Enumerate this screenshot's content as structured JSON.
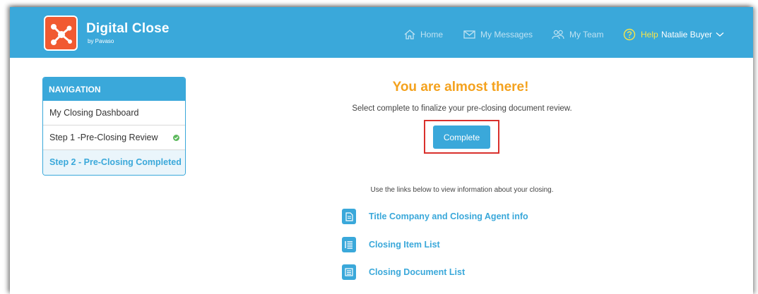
{
  "header": {
    "brand_title": "Digital Close",
    "brand_sub": "by Pavaso",
    "nav": {
      "home": "Home",
      "messages": "My Messages",
      "team": "My Team",
      "help": "Help",
      "user": "Natalie Buyer"
    }
  },
  "sidebar": {
    "heading": "NAVIGATION",
    "items": [
      {
        "label": "My Closing Dashboard"
      },
      {
        "label": "Step 1 -Pre-Closing Review",
        "completed": true
      },
      {
        "label": "Step 2 - Pre-Closing Completed",
        "active": true
      }
    ]
  },
  "main": {
    "headline": "You are almost there!",
    "subtext": "Select complete to finalize your pre-closing document review.",
    "complete_label": "Complete",
    "info_text": "Use the links below to view information about your closing.",
    "links": [
      {
        "label": "Title Company and Closing Agent info",
        "icon": "document-icon"
      },
      {
        "label": "Closing Item List",
        "icon": "list-icon"
      },
      {
        "label": "Closing Document List",
        "icon": "document-list-icon"
      }
    ]
  },
  "colors": {
    "header_bg": "#3aa8da",
    "accent_orange": "#f4a21e",
    "help_yellow": "#f7e54a",
    "logo_bg": "#f15a31",
    "highlight_red": "#d9302c",
    "check_green": "#5cb85c"
  }
}
